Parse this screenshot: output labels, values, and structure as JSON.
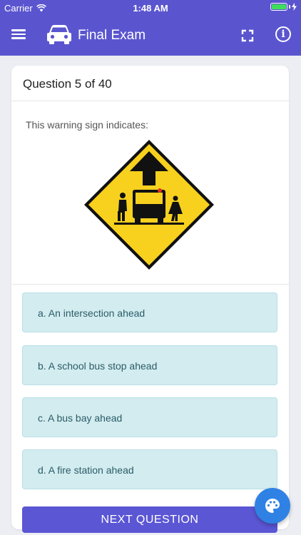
{
  "status_bar": {
    "carrier": "Carrier",
    "time": "1:48 AM"
  },
  "app_bar": {
    "title": "Final Exam",
    "icons": [
      "menu-icon",
      "car-icon",
      "fullscreen-icon",
      "info-icon"
    ]
  },
  "question": {
    "header": "Question 5 of 40",
    "prompt": "This warning sign indicates:",
    "sign_icon": "school-bus-stop-ahead-sign"
  },
  "options": [
    {
      "label": "a. An intersection ahead"
    },
    {
      "label": "b. A school bus stop ahead"
    },
    {
      "label": "c. A bus bay ahead"
    },
    {
      "label": "d. A fire station ahead"
    }
  ],
  "next_button": {
    "label": "NEXT QUESTION"
  },
  "fab": {
    "icon": "palette-icon"
  },
  "colors": {
    "primary": "#5a55cf",
    "option_bg": "#d3ecf0",
    "option_text": "#2a5c66",
    "sign_yellow": "#f7d11e",
    "fab": "#2f82e4"
  }
}
